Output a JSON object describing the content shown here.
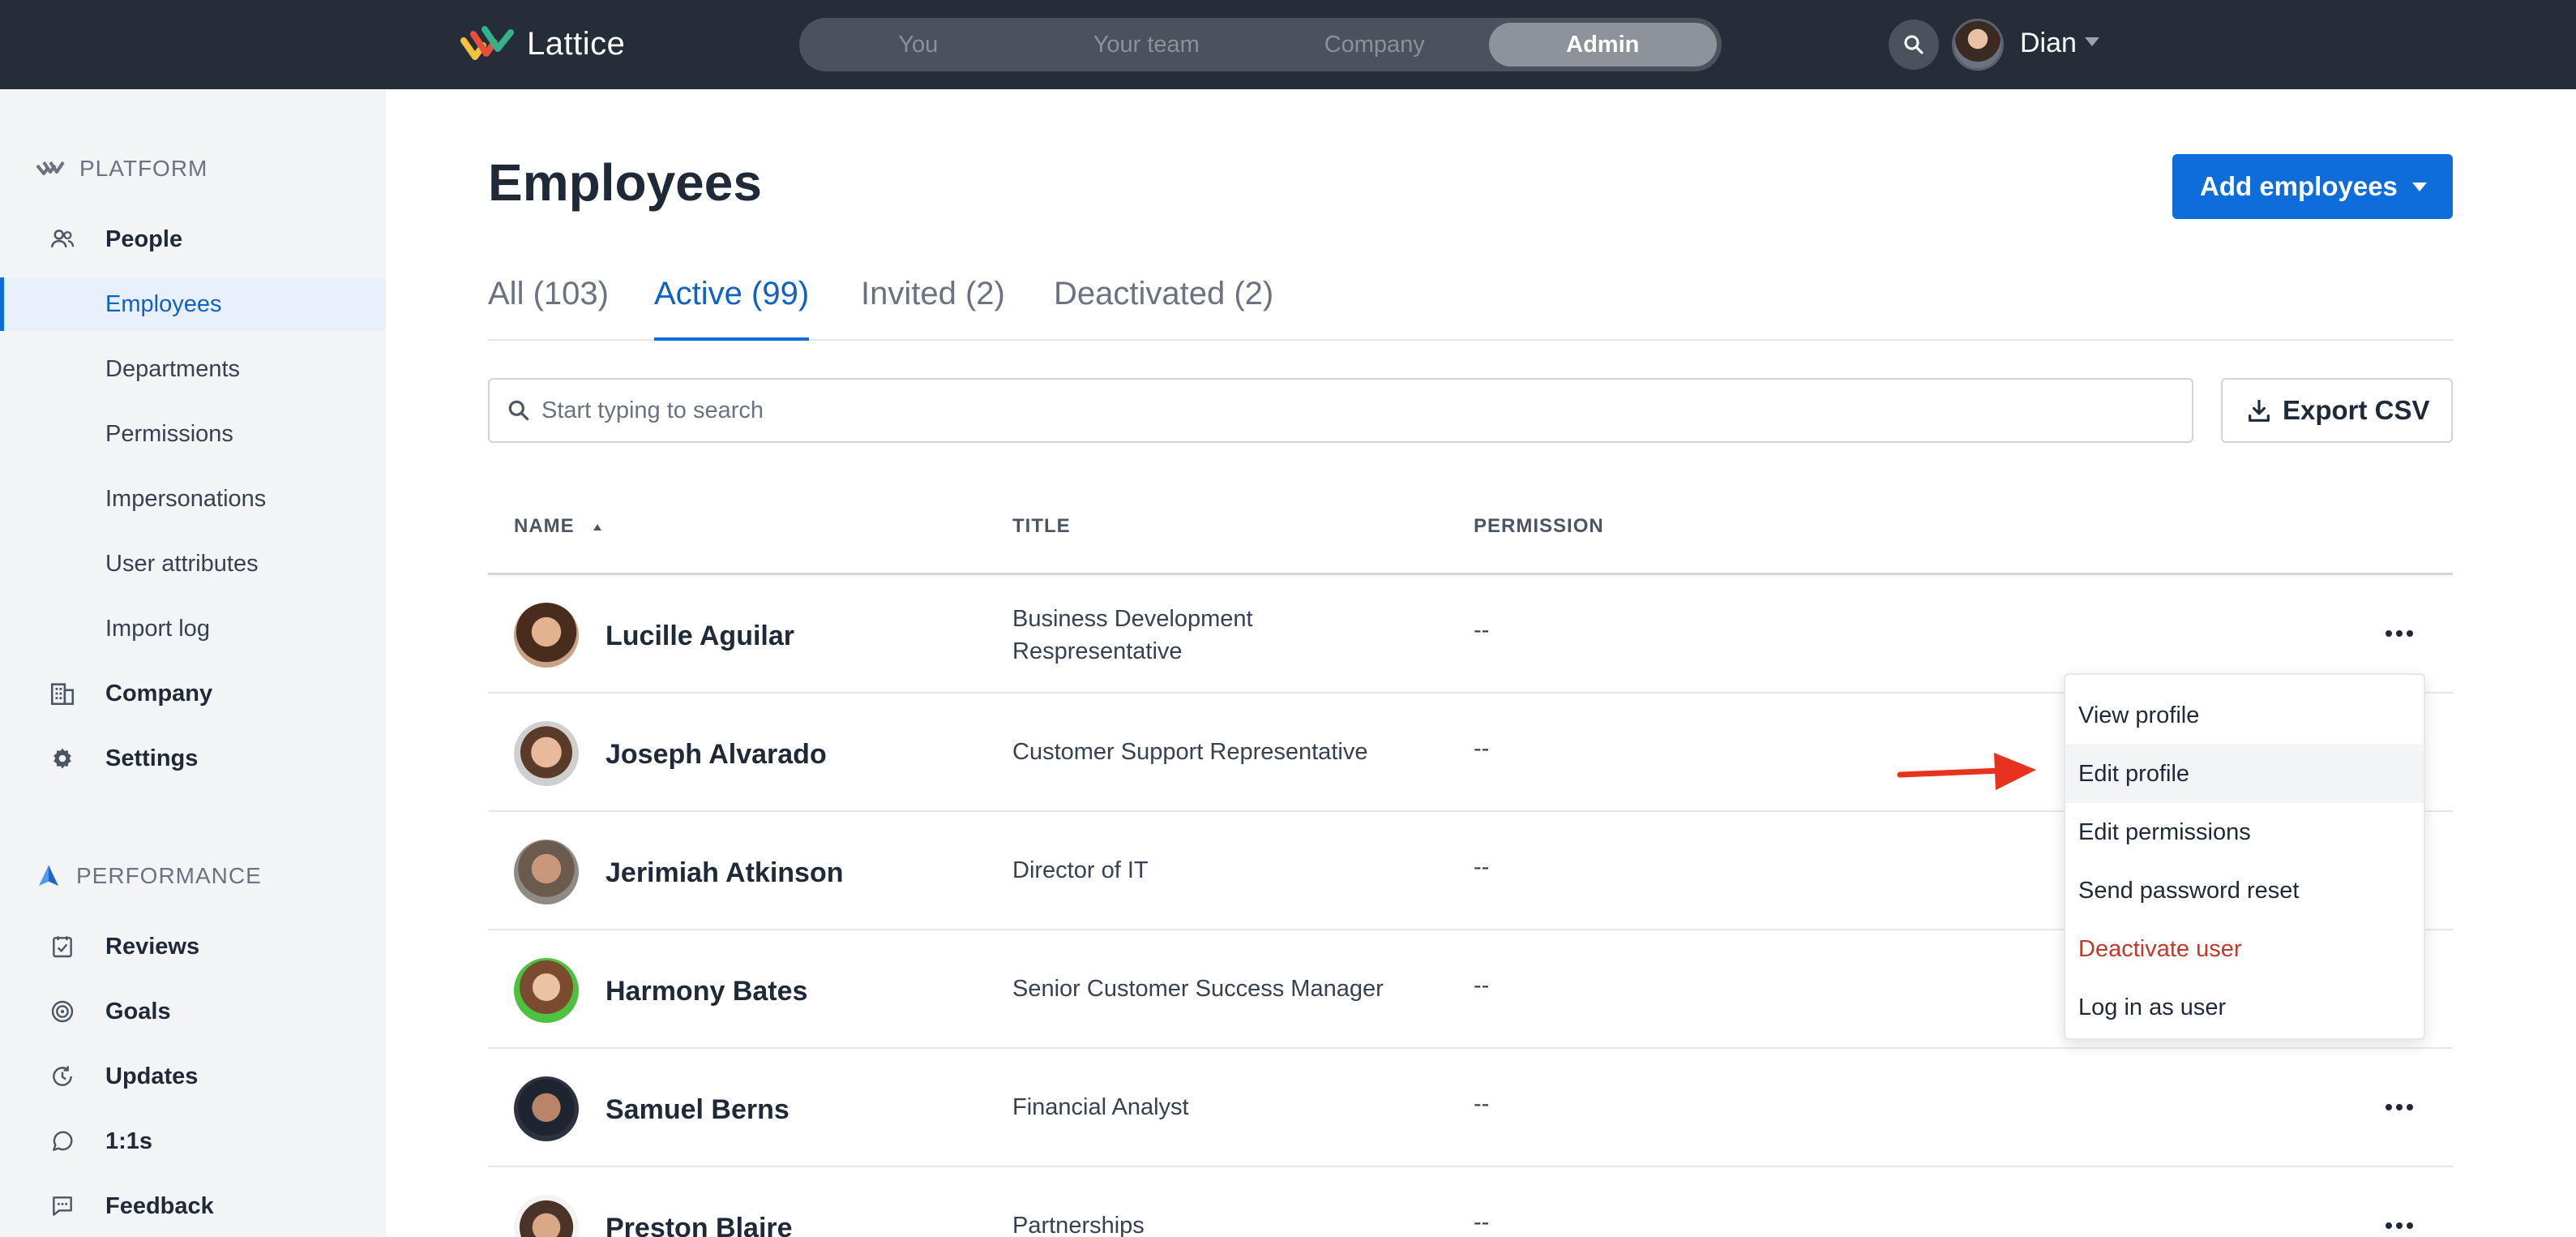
{
  "header": {
    "brand": "Lattice",
    "nav": [
      {
        "label": "You",
        "active": false
      },
      {
        "label": "Your team",
        "active": false
      },
      {
        "label": "Company",
        "active": false
      },
      {
        "label": "Admin",
        "active": true
      }
    ],
    "user_name": "Dian"
  },
  "sidebar": {
    "platform_label": "PLATFORM",
    "performance_label": "PERFORMANCE",
    "items": [
      {
        "label": "People",
        "icon": "people-icon"
      },
      {
        "label": "Employees",
        "active": true
      },
      {
        "label": "Departments"
      },
      {
        "label": "Permissions"
      },
      {
        "label": "Impersonations"
      },
      {
        "label": "User attributes"
      },
      {
        "label": "Import log"
      },
      {
        "label": "Company",
        "icon": "building-icon"
      },
      {
        "label": "Settings",
        "icon": "gear-icon"
      },
      {
        "label": "Reviews",
        "icon": "review-icon"
      },
      {
        "label": "Goals",
        "icon": "target-icon"
      },
      {
        "label": "Updates",
        "icon": "updates-icon"
      },
      {
        "label": "1:1s",
        "icon": "chat-icon"
      },
      {
        "label": "Feedback",
        "icon": "feedback-icon"
      }
    ]
  },
  "main": {
    "title": "Employees",
    "add_button": "Add employees",
    "tabs": [
      {
        "label": "All (103)",
        "active": false
      },
      {
        "label": "Active (99)",
        "active": true
      },
      {
        "label": "Invited (2)",
        "active": false
      },
      {
        "label": "Deactivated (2)",
        "active": false
      }
    ],
    "search_placeholder": "Start typing to search",
    "export_button": "Export CSV",
    "columns": [
      "NAME",
      "TITLE",
      "PERMISSION"
    ],
    "rows": [
      {
        "name": "Lucille Aguilar",
        "title": "Business Development Respresentative",
        "permission": "--"
      },
      {
        "name": "Joseph Alvarado",
        "title": "Customer Support Representative",
        "permission": "--"
      },
      {
        "name": "Jerimiah Atkinson",
        "title": "Director of IT",
        "permission": "--"
      },
      {
        "name": "Harmony Bates",
        "title": "Senior Customer Success Manager",
        "permission": "--"
      },
      {
        "name": "Samuel Berns",
        "title": "Financial Analyst",
        "permission": "--"
      },
      {
        "name": "Preston Blaire",
        "title": "Partnerships",
        "permission": "--"
      }
    ]
  },
  "dropdown": {
    "items": [
      {
        "label": "View profile"
      },
      {
        "label": "Edit profile",
        "hover": true
      },
      {
        "label": "Edit permissions"
      },
      {
        "label": "Send password reset"
      },
      {
        "label": "Deactivate user",
        "danger": true
      },
      {
        "label": "Log in as user"
      }
    ]
  },
  "colors": {
    "topbar": "#252d38",
    "accent": "#0e6ddb",
    "danger": "#c0392b",
    "annotation_arrow": "#e8321e"
  }
}
